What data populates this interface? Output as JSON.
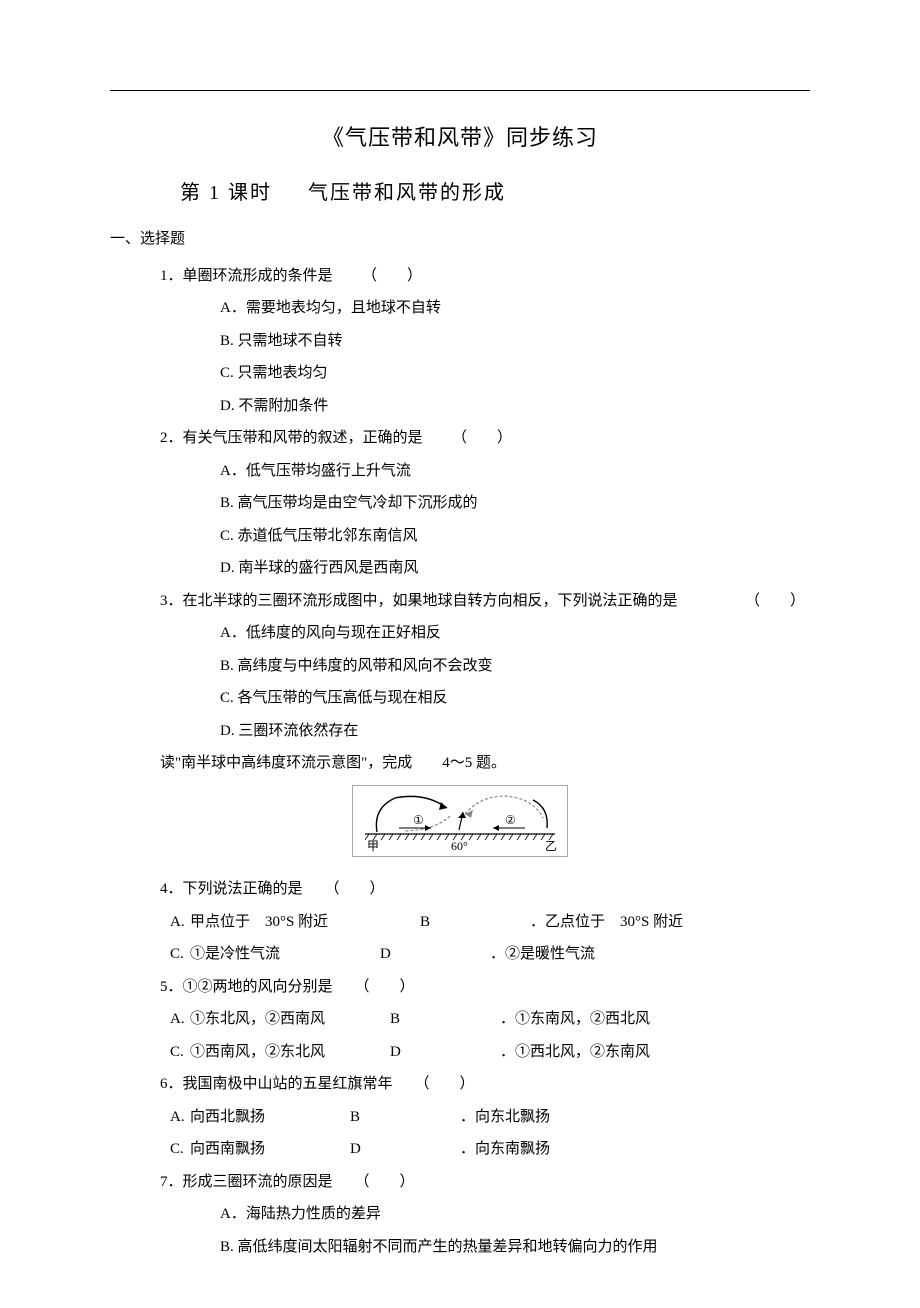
{
  "title": "《气压带和风带》同步练习",
  "subtitle_period": "第 1 课时",
  "subtitle_name": "气压带和风带的形成",
  "section1": "一、选择题",
  "q1": {
    "stem": "1．单圈环流形成的条件是",
    "paren": "（　　）",
    "A": "A．需要地表均匀，且地球不自转",
    "B": "B.  只需地球不自转",
    "C": "C.  只需地表均匀",
    "D": "D.  不需附加条件"
  },
  "q2": {
    "stem": "2．有关气压带和风带的叙述，正确的是",
    "paren": "（　　）",
    "A": "A．低气压带均盛行上升气流",
    "B": "B.  高气压带均是由空气冷却下沉形成的",
    "C": "C.  赤道低气压带北邻东南信风",
    "D": "D.  南半球的盛行西风是西南风"
  },
  "q3": {
    "stem": "3．在北半球的三圈环流形成图中，如果地球自转方向相反，下列说法正确的是",
    "paren": "（　　）",
    "A": "A．低纬度的风向与现在正好相反",
    "B": "B.  高纬度与中纬度的风带和风向不会改变",
    "C": "C.  各气压带的气压高低与现在相反",
    "D": "D.  三圈环流依然存在"
  },
  "instruction": "读\"南半球中高纬度环流示意图\"，完成　　4～5 题。",
  "diagram": {
    "label_left": "甲",
    "label_mid": "60°",
    "label_right": "乙",
    "circ1": "①",
    "circ2": "②"
  },
  "q4": {
    "stem": "4．下列说法正确的是",
    "paren": "（　　）",
    "A_letter": "A.",
    "A_text": "甲点位于　30°S 附近",
    "B_letter": "B",
    "B_text": "．乙点位于　30°S 附近",
    "C_letter": "C.",
    "C_text": "①是冷性气流",
    "D_letter": "D",
    "D_text": "．②是暖性气流"
  },
  "q5": {
    "stem": "5．①②两地的风向分别是",
    "paren": "（　　）",
    "A_letter": "A.",
    "A_text": "①东北风，②西南风",
    "B_letter": "B",
    "B_text": "．①东南风，②西北风",
    "C_letter": "C.",
    "C_text": "①西南风，②东北风",
    "D_letter": "D",
    "D_text": "．①西北风，②东南风"
  },
  "q6": {
    "stem": "6．我国南极中山站的五星红旗常年",
    "paren": "（　　）",
    "A_letter": "A.",
    "A_text": "向西北飘扬",
    "B_letter": "B",
    "B_text": "．向东北飘扬",
    "C_letter": "C.",
    "C_text": "向西南飘扬",
    "D_letter": "D",
    "D_text": "．向东南飘扬"
  },
  "q7": {
    "stem": "7．形成三圈环流的原因是",
    "paren": "（　　）",
    "A": "A．海陆热力性质的差异",
    "B": "B.  高低纬度间太阳辐射不同而产生的热量差异和地转偏向力的作用"
  }
}
